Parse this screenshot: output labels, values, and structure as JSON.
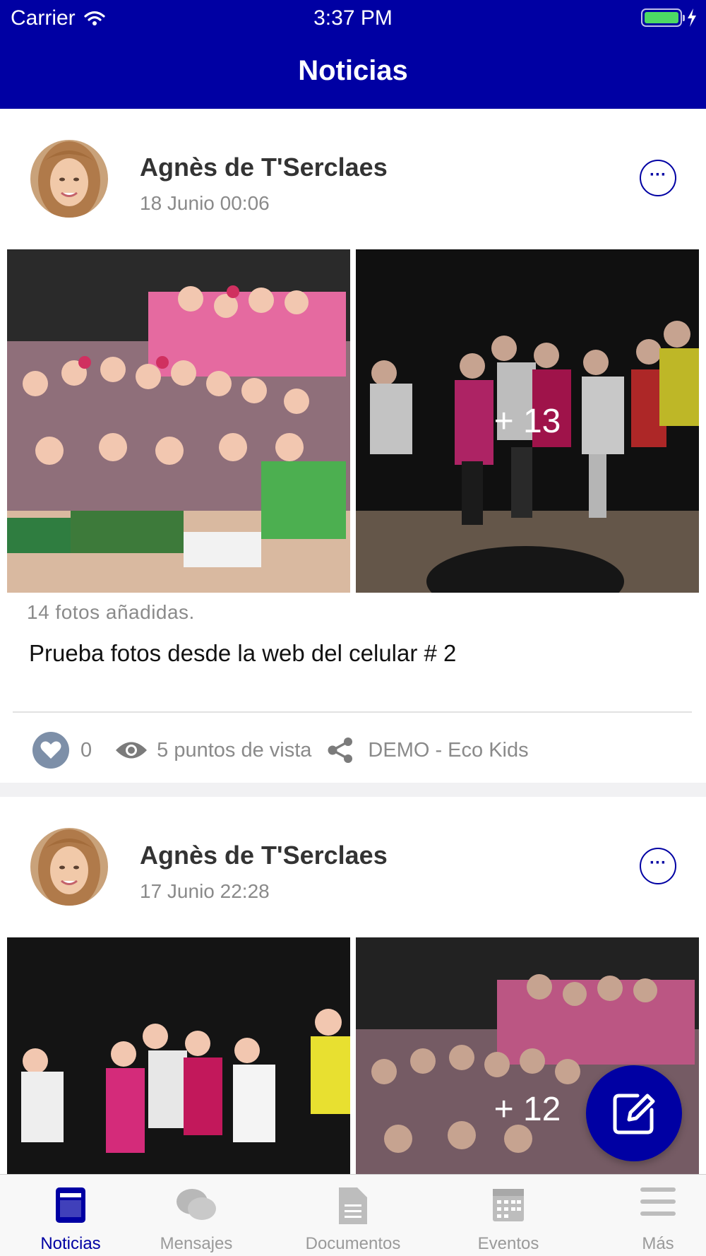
{
  "status_bar": {
    "carrier": "Carrier",
    "time": "3:37 PM"
  },
  "header": {
    "title": "Noticias"
  },
  "posts": [
    {
      "author": "Agnès de T'Serclaes",
      "date": "18 Junio 00:06",
      "more": "···",
      "photo_overlay": "+ 13",
      "photos_added": "14 fotos añadidas.",
      "text": "Prueba fotos desde la web del celular # 2",
      "likes": "0",
      "views": "5 puntos de vista",
      "group": "DEMO - Eco Kids"
    },
    {
      "author": "Agnès de T'Serclaes",
      "date": "17 Junio 22:28",
      "more": "···",
      "photo_overlay": "+ 12"
    }
  ],
  "tabs": [
    {
      "label": "Noticias",
      "icon": "news-icon",
      "active": true
    },
    {
      "label": "Mensajes",
      "icon": "chat-icon",
      "active": false
    },
    {
      "label": "Documentos",
      "icon": "document-icon",
      "active": false
    },
    {
      "label": "Eventos",
      "icon": "calendar-icon",
      "active": false
    },
    {
      "label": "Más",
      "icon": "menu-icon",
      "active": false
    }
  ],
  "colors": {
    "brand": "#0000a3",
    "tab_inactive": "#9a9a9a"
  }
}
